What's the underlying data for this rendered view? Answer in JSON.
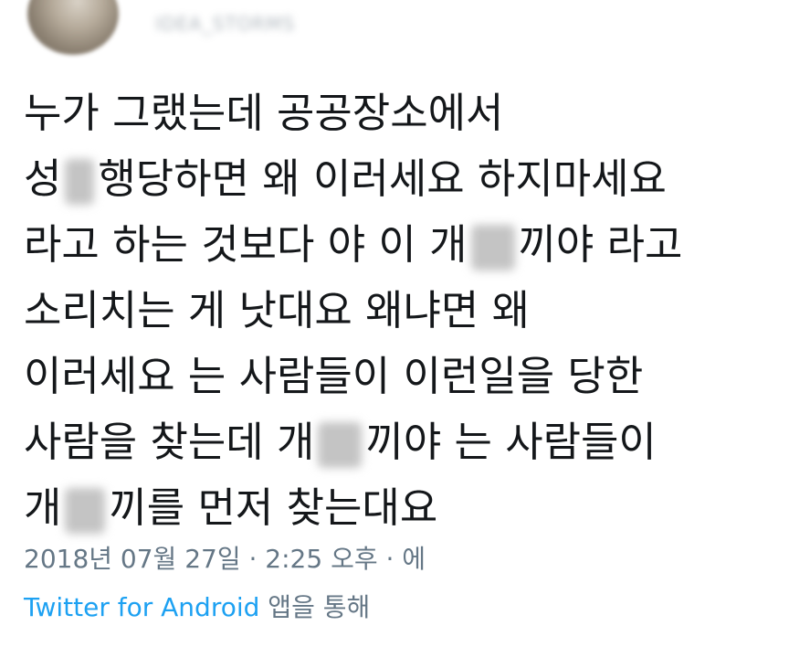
{
  "header": {
    "username": "IDEA_STORMS"
  },
  "tweet": {
    "lines": [
      [
        "누가 그랬는데 공공장소에서"
      ],
      [
        "성",
        "행당하면 왜 이러세요 하지마세요"
      ],
      [
        "라고 하는 것보다 야 이 개",
        "끼야 라고"
      ],
      [
        "소리치는 게 낫대요 왜냐면 왜"
      ],
      [
        "이러세요 는 사람들이 이런일을 당한"
      ],
      [
        "사람을 찾는데 개",
        "끼야 는 사람들이"
      ],
      [
        "개",
        "끼를 먼저 찾는대요"
      ]
    ]
  },
  "meta": {
    "timestamp": "2018년 07월 27일 · 2:25 오후 · 에",
    "source_app": "Twitter for Android",
    "source_suffix": " 앱을 통해"
  },
  "colors": {
    "text": "#14171a",
    "meta": "#657786",
    "link": "#1da1f2"
  }
}
